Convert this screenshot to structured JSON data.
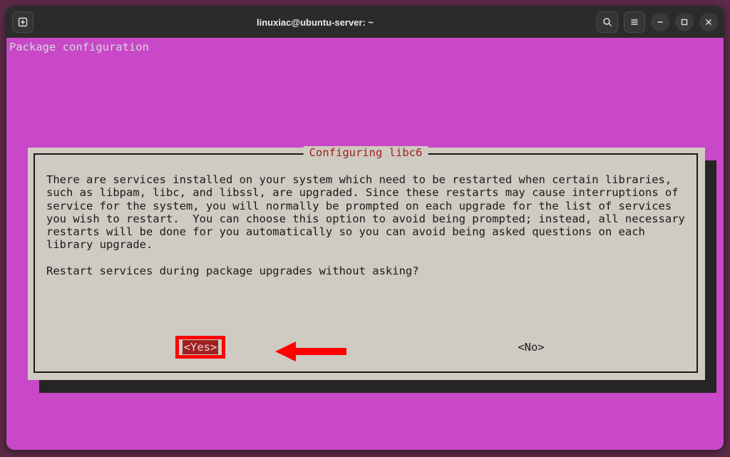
{
  "titlebar": {
    "title": "linuxiac@ubuntu-server: ~"
  },
  "terminal": {
    "header": "Package configuration"
  },
  "dialog": {
    "title": "Configuring libc6",
    "body": "There are services installed on your system which need to be restarted when certain libraries, such as libpam, libc, and libssl, are upgraded. Since these restarts may cause interruptions of service for the system, you will normally be prompted on each upgrade for the list of services you wish to restart.  You can choose this option to avoid being prompted; instead, all necessary restarts will be done for you automatically so you can avoid being asked questions on each library upgrade.",
    "question": "Restart services during package upgrades without asking?",
    "buttons": {
      "yes": "<Yes>",
      "no": "<No>"
    },
    "selected": "yes"
  },
  "annotation": {
    "highlight_target": "yes",
    "arrow_color": "#ff0000"
  }
}
